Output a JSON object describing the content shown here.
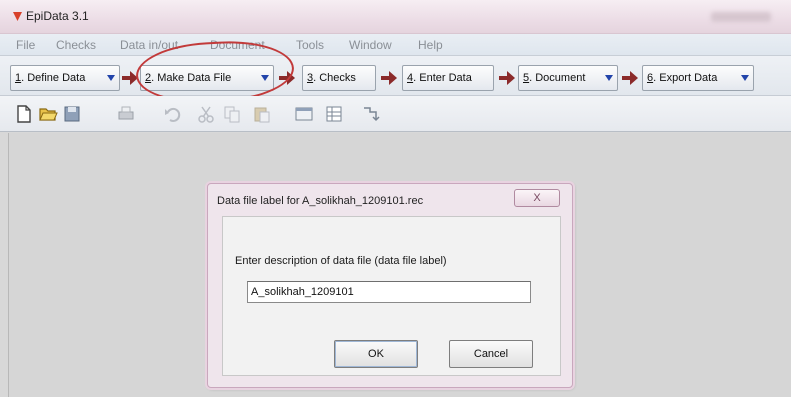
{
  "window": {
    "title": "EpiData 3.1"
  },
  "menu": [
    "File",
    "Checks",
    "Data in/out",
    "Document",
    "Tools",
    "Window",
    "Help"
  ],
  "workflow": [
    {
      "num": "1",
      "label": ". Define Data"
    },
    {
      "num": "2",
      "label": ". Make Data File"
    },
    {
      "num": "3",
      "label": ". Checks"
    },
    {
      "num": "4",
      "label": ". Enter Data"
    },
    {
      "num": "5",
      "label": ". Document"
    },
    {
      "num": "6",
      "label": ". Export Data"
    }
  ],
  "toolbar_icons": [
    "new-file-icon",
    "open-folder-icon",
    "save-icon",
    "print-icon",
    "undo-icon",
    "cut-icon",
    "copy-icon",
    "paste-icon",
    "window-icon",
    "table-icon",
    "field-icon"
  ],
  "dialog": {
    "title": "Data file label for A_solikhah_1209101.rec",
    "close_label": "X",
    "prompt": "Enter description of data file (data file label)",
    "input_value": "A_solikhah_1209101",
    "ok_label": "OK",
    "cancel_label": "Cancel"
  },
  "colors": {
    "annotation_circle": "#c23a3a",
    "workflow_arrow": "#8b2a2a",
    "caret": "#2244aa"
  }
}
